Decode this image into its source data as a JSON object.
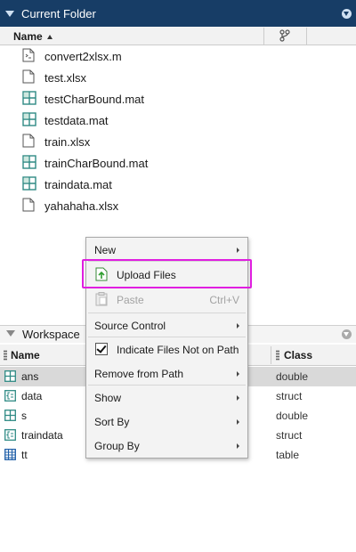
{
  "current_folder": {
    "title": "Current Folder",
    "column_name": "Name",
    "files": [
      {
        "name": "convert2xlsx.m",
        "type": "script"
      },
      {
        "name": "test.xlsx",
        "type": "file"
      },
      {
        "name": "testCharBound.mat",
        "type": "mat"
      },
      {
        "name": "testdata.mat",
        "type": "mat"
      },
      {
        "name": "train.xlsx",
        "type": "file"
      },
      {
        "name": "trainCharBound.mat",
        "type": "mat"
      },
      {
        "name": "traindata.mat",
        "type": "mat"
      },
      {
        "name": "yahahaha.xlsx",
        "type": "file"
      }
    ]
  },
  "workspace": {
    "title": "Workspace",
    "col_name": "Name",
    "col_class": "Class",
    "variables": [
      {
        "name": "ans",
        "class": "double",
        "icon": "matrix-icon",
        "selected": true
      },
      {
        "name": "data",
        "class": "struct",
        "icon": "struct-icon",
        "selected": false
      },
      {
        "name": "s",
        "class": "double",
        "icon": "matrix-icon",
        "selected": false
      },
      {
        "name": "traindata",
        "class": "struct",
        "icon": "struct-icon",
        "selected": false
      },
      {
        "name": "tt",
        "class": "table",
        "icon": "table-icon",
        "selected": false
      }
    ]
  },
  "context_menu": {
    "new": "New",
    "upload_files": "Upload Files",
    "paste": "Paste",
    "paste_shortcut": "Ctrl+V",
    "source_control": "Source Control",
    "indicate_files": "Indicate Files Not on Path",
    "remove_from_path": "Remove from Path",
    "show": "Show",
    "sort_by": "Sort By",
    "group_by": "Group By"
  },
  "colors": {
    "header_bg": "#173d66",
    "highlight": "#e01ee0",
    "mat_icon": "#2f8a84"
  }
}
